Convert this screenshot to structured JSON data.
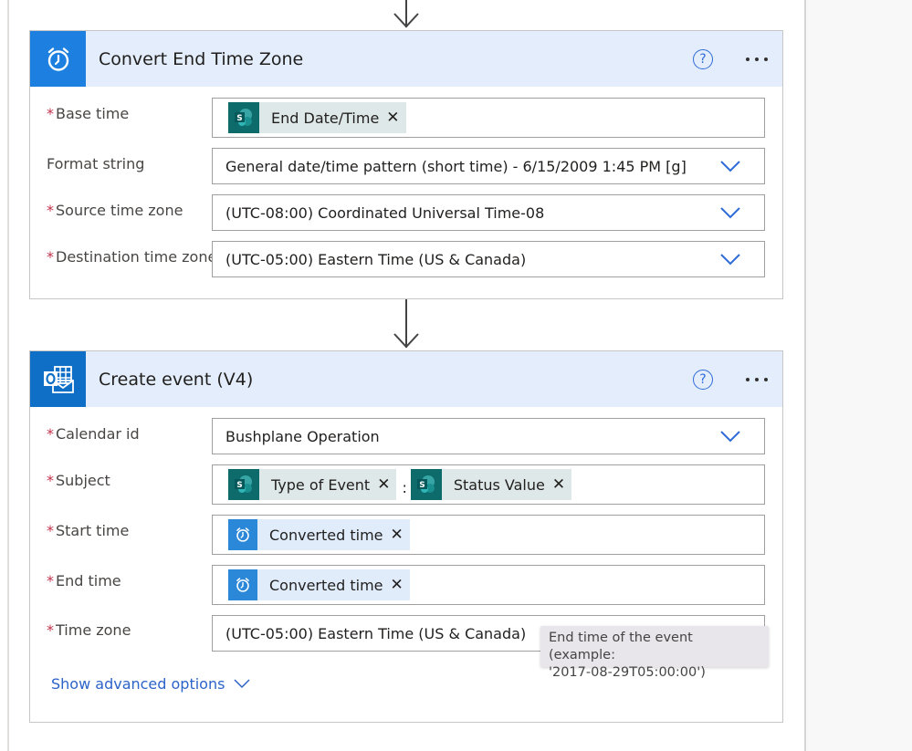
{
  "cards": [
    {
      "title": "Convert End Time Zone",
      "icon": "alarm-clock-icon",
      "fields": [
        {
          "label": "Base time",
          "required": true,
          "type": "tokens",
          "tokens": [
            {
              "label": "End Date/Time",
              "icon": "sharepoint-icon"
            }
          ]
        },
        {
          "label": "Format string",
          "required": false,
          "type": "dropdown",
          "value": "General date/time pattern (short time) - 6/15/2009 1:45 PM [g]"
        },
        {
          "label": "Source time zone",
          "required": true,
          "type": "dropdown",
          "value": "(UTC-08:00) Coordinated Universal Time-08"
        },
        {
          "label": "Destination time zone",
          "required": true,
          "type": "dropdown",
          "value": "(UTC-05:00) Eastern Time (US & Canada)"
        }
      ]
    },
    {
      "title": "Create event (V4)",
      "icon": "outlook-calendar-icon",
      "fields": [
        {
          "label": "Calendar id",
          "required": true,
          "type": "dropdown",
          "value": "Bushplane Operation"
        },
        {
          "label": "Subject",
          "required": true,
          "type": "tokens",
          "tokens": [
            {
              "label": "Type of Event",
              "icon": "sharepoint-icon"
            },
            {
              "label": "Status Value",
              "icon": "sharepoint-icon"
            }
          ],
          "separator": ":"
        },
        {
          "label": "Start time",
          "required": true,
          "type": "tokens",
          "tokens": [
            {
              "label": "Converted time",
              "icon": "alarm-clock-icon"
            }
          ]
        },
        {
          "label": "End time",
          "required": true,
          "type": "tokens",
          "tokens": [
            {
              "label": "Converted time",
              "icon": "alarm-clock-icon"
            }
          ]
        },
        {
          "label": "Time zone",
          "required": true,
          "type": "dropdown",
          "value": "(UTC-05:00) Eastern Time (US & Canada)"
        }
      ],
      "advanced_link": "Show advanced options"
    }
  ],
  "required_marker": "*",
  "help_label": "?",
  "token_remove": "✕",
  "tooltip": {
    "line1": "End time of the event (example:",
    "line2": "'2017-08-29T05:00:00')"
  },
  "colors": {
    "accent": "#1d7fe0",
    "header_bg": "#e3edfb",
    "sharepoint": "#0e6b6b",
    "required": "#c4314b",
    "link": "#2c63c9"
  }
}
